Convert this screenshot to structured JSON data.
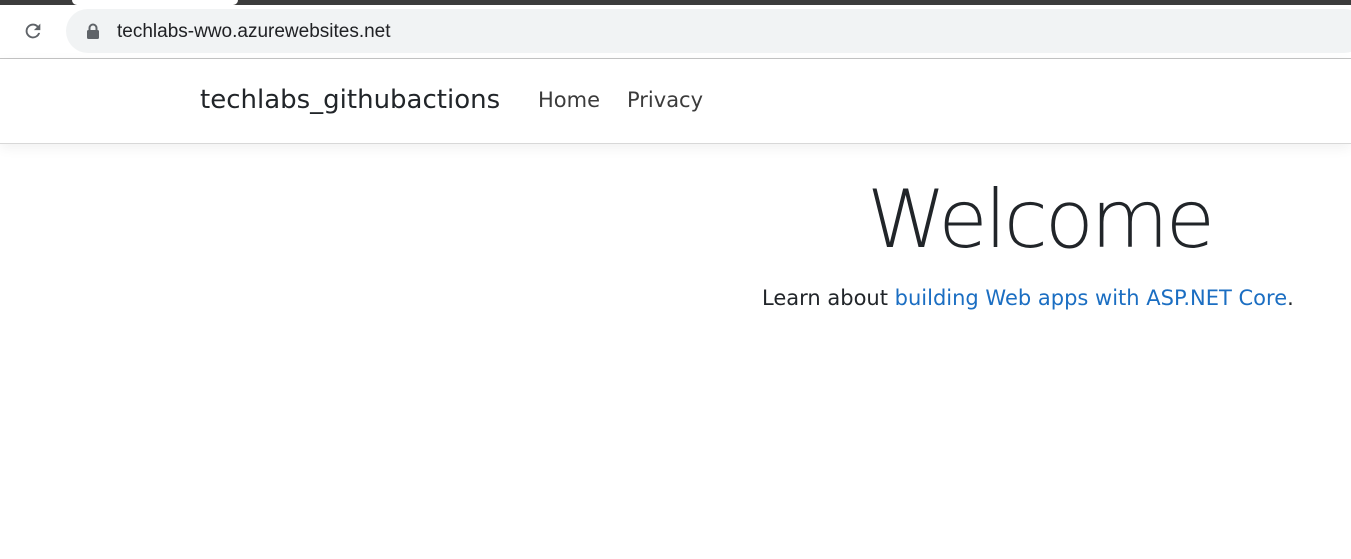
{
  "browser": {
    "url": "techlabs-wwo.azurewebsites.net",
    "reload_icon": "reload-icon",
    "lock_icon": "lock-icon"
  },
  "navbar": {
    "brand": "techlabs_githubactions",
    "links": [
      {
        "label": "Home"
      },
      {
        "label": "Privacy"
      }
    ]
  },
  "main": {
    "heading": "Welcome",
    "intro_prefix": "Learn about ",
    "intro_link": "building Web apps with ASP.NET Core",
    "intro_suffix": "."
  },
  "colors": {
    "link": "#1b6ec2",
    "text": "#212529",
    "omnibox_bg": "#f1f3f4"
  }
}
